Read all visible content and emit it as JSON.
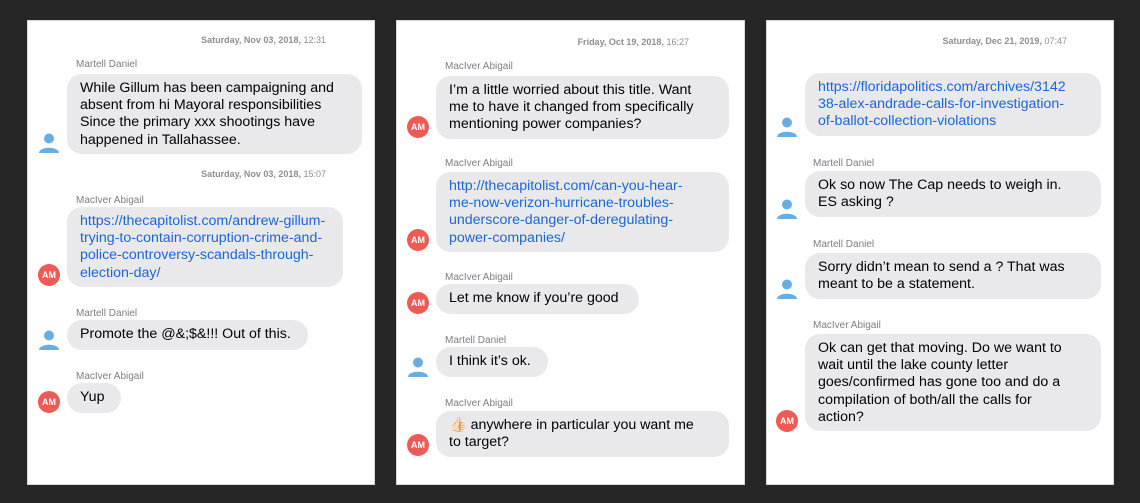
{
  "colors": {
    "background": "#262626",
    "bubble": "#e9e9eb",
    "link": "#1a66d9",
    "am_avatar": "#ef5a54",
    "person_avatar": "#6aaee0"
  },
  "panels": [
    {
      "timestamps": [
        {
          "date": "Saturday, Nov 03, 2018,",
          "time": "12:31"
        },
        {
          "date": "Saturday, Nov 03, 2018,",
          "time": "15:07"
        }
      ],
      "messages": [
        {
          "sender": "Martell Daniel",
          "text": "While Gillum has been campaigning and\nabsent from hi Mayoral responsibilities\nSince the primary xxx shootings have\nhappened in Tallahassee.",
          "avatar": "person-icon"
        },
        {
          "sender": "MacIver Abigail",
          "text": "https://thecapitolist.com/andrew-gillum-\ntrying-to-contain-corruption-crime-and-\npolice-controversy-scandals-through-\nelection-day/",
          "avatar": "AM"
        },
        {
          "sender": "Martell Daniel",
          "text": "Promote the @&;$&!!! Out of this.",
          "avatar": "person-icon"
        },
        {
          "sender": "MacIver Abigail",
          "text": "Yup",
          "avatar": "AM"
        }
      ]
    },
    {
      "timestamps": [
        {
          "date": "Friday, Oct 19, 2018,",
          "time": "16:27"
        }
      ],
      "messages": [
        {
          "sender": "MacIver Abigail",
          "text": "I’m a little worried about this title. Want\nme to have it changed from specifically\nmentioning power companies?",
          "avatar": "AM"
        },
        {
          "sender": "MacIver Abigail",
          "text": "http://thecapitolist.com/can-you-hear-\nme-now-verizon-hurricane-troubles-\nunderscore-danger-of-deregulating-\npower-companies/",
          "avatar": "AM"
        },
        {
          "sender": "MacIver Abigail",
          "text": "Let me know if you’re good",
          "avatar": "AM"
        },
        {
          "sender": "Martell Daniel",
          "text": "I think it’s ok.",
          "avatar": "person-icon"
        },
        {
          "sender": "MacIver Abigail",
          "text": "anywhere in particular you want me\nto target?",
          "emoji": "👍🏻",
          "avatar": "AM"
        }
      ]
    },
    {
      "timestamps": [
        {
          "date": "Saturday, Dec 21, 2019,",
          "time": "07:47"
        }
      ],
      "messages": [
        {
          "sender": "",
          "text": "https://floridapolitics.com/archives/3142\n38-alex-andrade-calls-for-investigation-\nof-ballot-collection-violations",
          "avatar": "person-icon"
        },
        {
          "sender": "Martell Daniel",
          "text": "Ok so now The Cap needs to weigh in.\nES asking ?",
          "avatar": "person-icon"
        },
        {
          "sender": "Martell Daniel",
          "text": "Sorry didn’t mean to send a ? That was\nmeant to be a statement.",
          "avatar": "person-icon"
        },
        {
          "sender": "MacIver Abigail",
          "text": "Ok can get that moving. Do we want to\nwait until the lake county letter\ngoes/confirmed has gone too and do a\ncompilation of both/all the calls for\naction?",
          "avatar": "AM"
        }
      ]
    }
  ]
}
